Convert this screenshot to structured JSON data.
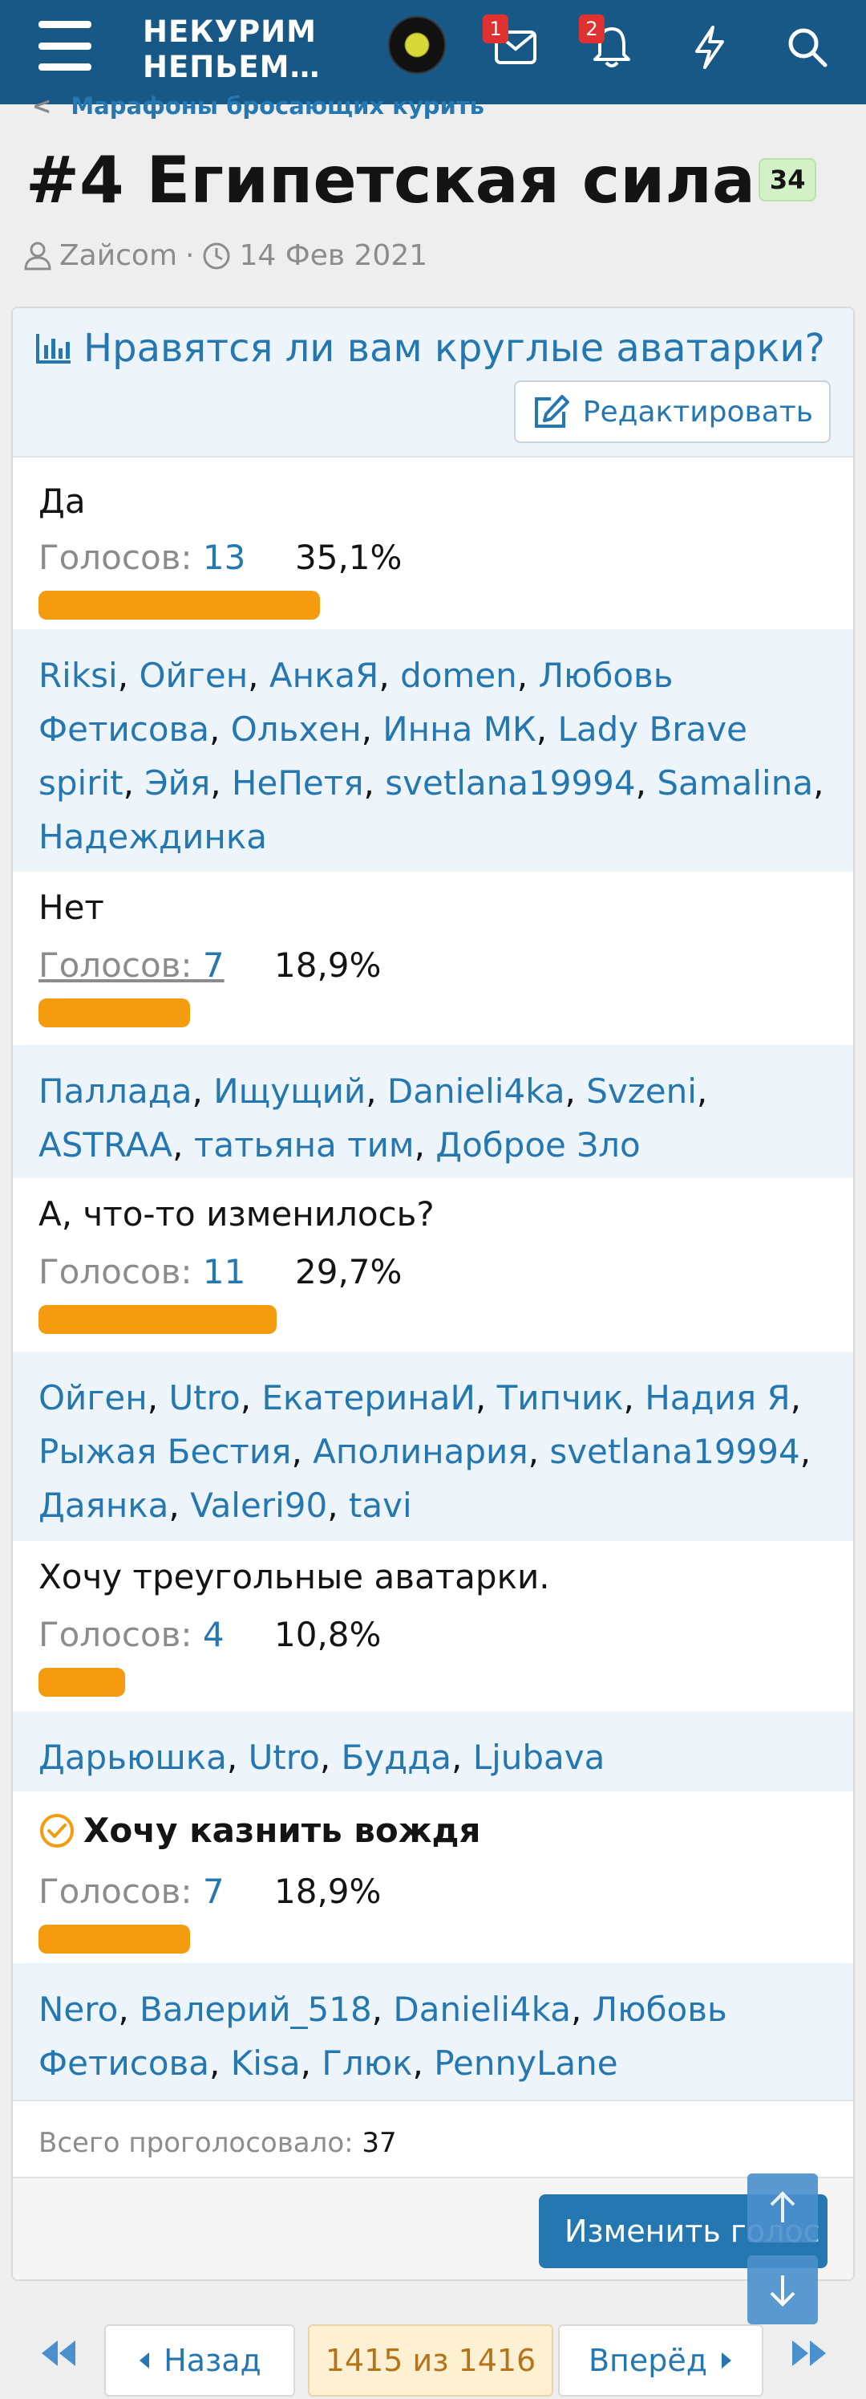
{
  "header": {
    "logo_line1": "НЕКУРИМ",
    "logo_line2": "НЕПЬЕМ…",
    "messages_badge": "1",
    "alerts_badge": "2"
  },
  "breadcrumb": "Марафоны бросающих курить",
  "thread": {
    "title": "#4 Египетская сила",
    "badge": "34",
    "author": "Zайcom",
    "separator": "·",
    "date": "14 Фев 2021"
  },
  "poll": {
    "question": "Нравятся ли вам круглые аватарки?",
    "edit_label": "Редактировать",
    "votes_label": "Голосов:",
    "options": [
      {
        "label": "Да",
        "votes": "13",
        "percent": "35,1%",
        "share": 0.351,
        "voters": [
          "Riksi",
          "Ойген",
          "АнкаЯ",
          "domen",
          "Любовь Фетисова",
          "Ольхен",
          "Инна МК",
          "Lady Brave spirit",
          "Эйя",
          "НеПетя",
          "svetlana19994",
          "Samalina",
          "Надеждинка"
        ]
      },
      {
        "label": "Нет",
        "votes": "7",
        "percent": "18,9%",
        "share": 0.189,
        "voters": [
          "Паллада",
          "Ищущий",
          "Danieli4ka",
          "Svzeni",
          "ASTRAA",
          "татьяна тим",
          "Доброе Зло"
        ]
      },
      {
        "label": "А, что-то изменилось?",
        "votes": "11",
        "percent": "29,7%",
        "share": 0.297,
        "voters": [
          "Ойген",
          "Utro",
          "ЕкатеринаИ",
          "Типчик",
          "Надия Я",
          "Рыжая Бестия",
          "Аполинария",
          "svetlana19994",
          "Даянка",
          "Valeri90",
          "tavi"
        ]
      },
      {
        "label": "Хочу треугольные аватарки.",
        "votes": "4",
        "percent": "10,8%",
        "share": 0.108,
        "voters": [
          "Дарьюшка",
          "Utro",
          "Будда",
          "Ljubava"
        ]
      },
      {
        "label": "Хочу казнить вождя",
        "votes": "7",
        "percent": "18,9%",
        "share": 0.189,
        "voters": [
          "Nero",
          "Валерий_518",
          "Danieli4ka",
          "Любовь Фетисова",
          "Kisa",
          "Глюк",
          "PennyLane"
        ]
      }
    ],
    "total_label": "Всего проголосовало:",
    "total": "37",
    "change_vote_label": "Изменить голос"
  },
  "pagination": {
    "prev_label": "Назад",
    "current": "1415 из 1416",
    "next_label": "Вперёд"
  },
  "colors": {
    "header_bg": "#185886",
    "link": "#2577b1",
    "bar": "#f59b0f",
    "voters_bg": "#edf5fb"
  }
}
